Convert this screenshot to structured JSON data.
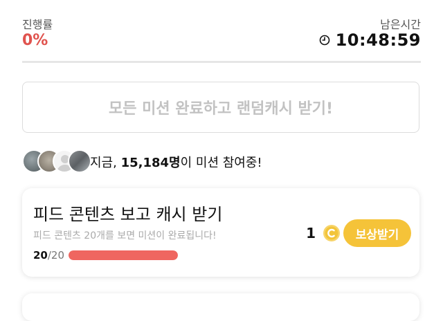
{
  "header": {
    "progress_label": "진행률",
    "progress_value": "0%",
    "time_label": "남은시간",
    "time_value": "10:48:59",
    "clock_icon": "clock-icon"
  },
  "main_button": {
    "label": "모든 미션 완료하고 랜덤캐시 받기!"
  },
  "participants": {
    "prefix": "지금, ",
    "count": "15,184명",
    "suffix": "이 미션 참여중!"
  },
  "mission": {
    "title": "피드 콘텐츠 보고 캐시 받기",
    "description": "피드 콘텐츠 20개를 보면 미션이 완료됩니다!",
    "progress_current": "20",
    "progress_total": "/20",
    "progress_fraction": 1.0,
    "reward_amount": "1",
    "coin_icon": "coin-icon",
    "claim_label": "보상받기"
  },
  "colors": {
    "accent_red": "#e0534e",
    "progress_bar": "#ef6660",
    "claim_button": "#f5c339",
    "coin": "#f2c43a"
  }
}
